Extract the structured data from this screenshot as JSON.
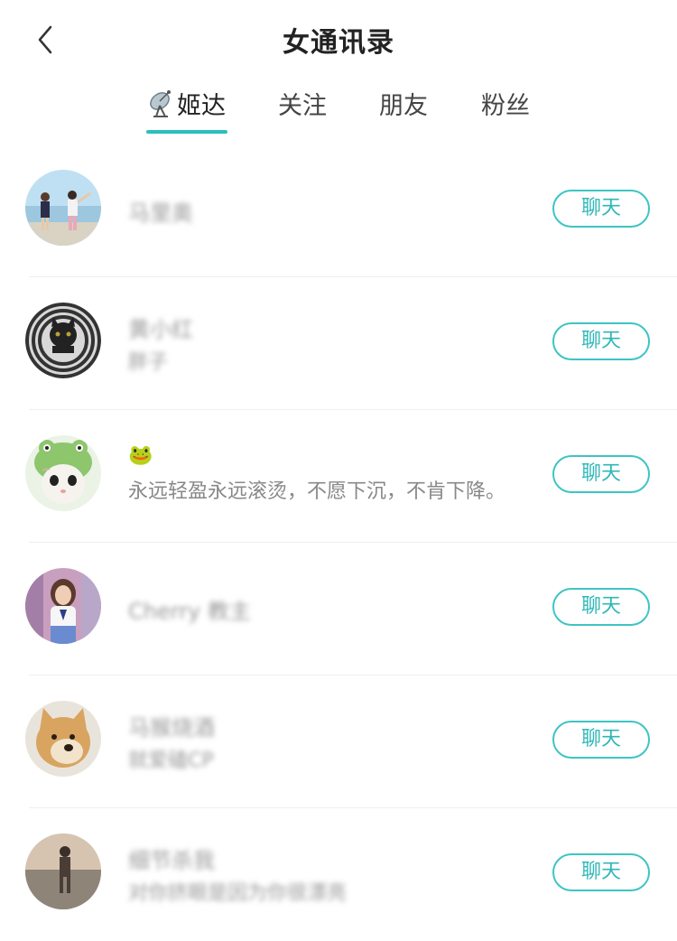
{
  "header": {
    "title": "女通讯录"
  },
  "tabs": [
    {
      "label": "姬达",
      "icon": "satellite-dish-icon",
      "active": true
    },
    {
      "label": "关注",
      "active": false
    },
    {
      "label": "朋友",
      "active": false
    },
    {
      "label": "粉丝",
      "active": false
    }
  ],
  "accent_color": "#2bbfbf",
  "contacts": [
    {
      "name": "马里奥",
      "subtitle": "",
      "avatar": "beach-couple-photo",
      "chat_label": "聊天"
    },
    {
      "name": "黄小红",
      "subtitle": "胖子",
      "avatar": "black-cat-photo",
      "chat_label": "聊天"
    },
    {
      "name": "🐸",
      "subtitle": "永远轻盈永远滚烫，不愿下沉，不肯下降。",
      "avatar": "cat-in-frog-hat-photo",
      "chat_label": "聊天"
    },
    {
      "name": "Cherry 教主",
      "subtitle": "",
      "avatar": "girl-portrait-photo",
      "chat_label": "聊天"
    },
    {
      "name": "马猴烧酒",
      "subtitle": "就爱磕CP",
      "avatar": "shiba-dog-photo",
      "chat_label": "聊天"
    },
    {
      "name": "细节杀我",
      "subtitle": "对你挤眼是因为你很漂亮",
      "avatar": "sunset-person-photo",
      "chat_label": "聊天"
    }
  ]
}
